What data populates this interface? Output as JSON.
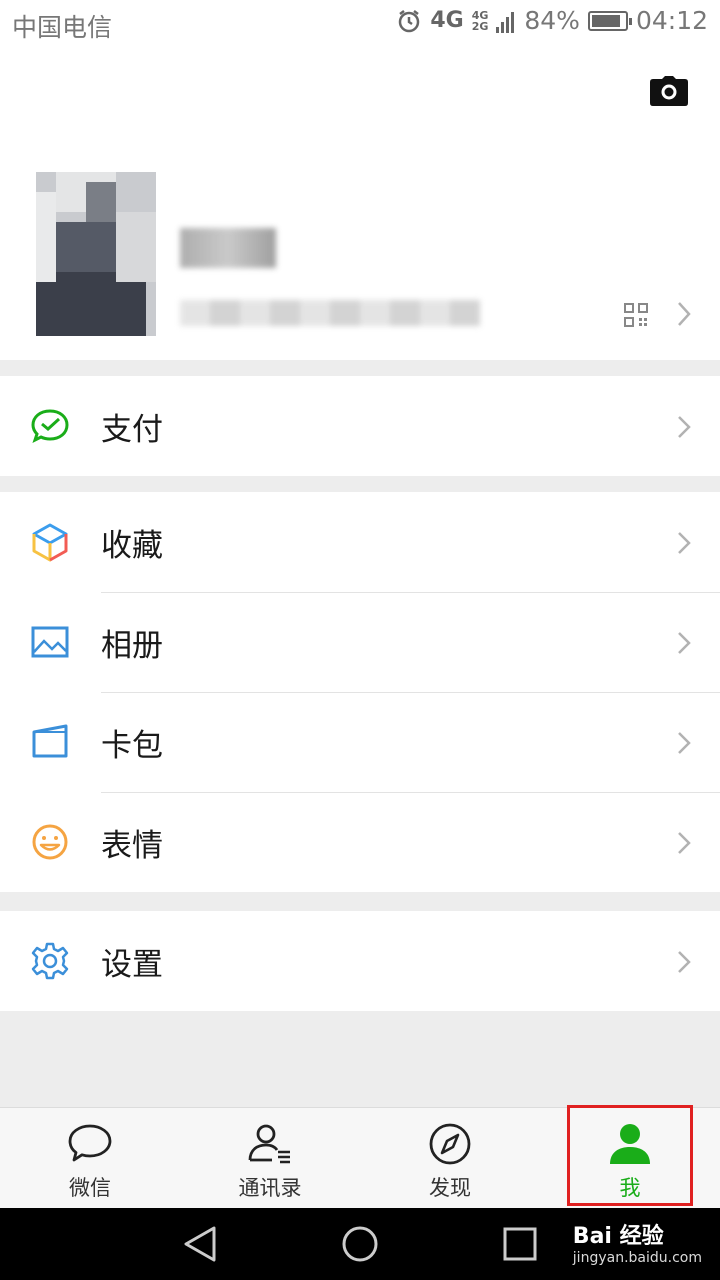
{
  "status_bar": {
    "carrier": "中国电信",
    "network": "4G",
    "network_secondary_top": "4G",
    "network_secondary_bottom": "2G",
    "battery": "84%",
    "time": "04:12"
  },
  "menu": {
    "pay": "支付",
    "favorites": "收藏",
    "album": "相册",
    "cards": "卡包",
    "stickers": "表情",
    "settings": "设置"
  },
  "tabs": {
    "chats": "微信",
    "contacts": "通讯录",
    "discover": "发现",
    "me": "我"
  },
  "watermark": {
    "brand": "Bai 经验",
    "url": "jingyan.baidu.com"
  },
  "colors": {
    "accent_green": "#1aad19",
    "highlight_red": "#e02020"
  },
  "icons": {
    "pay": "wechat-pay-icon",
    "favorites": "cube-icon",
    "album": "picture-icon",
    "cards": "card-wallet-icon",
    "stickers": "smiley-icon",
    "settings": "gear-icon"
  }
}
